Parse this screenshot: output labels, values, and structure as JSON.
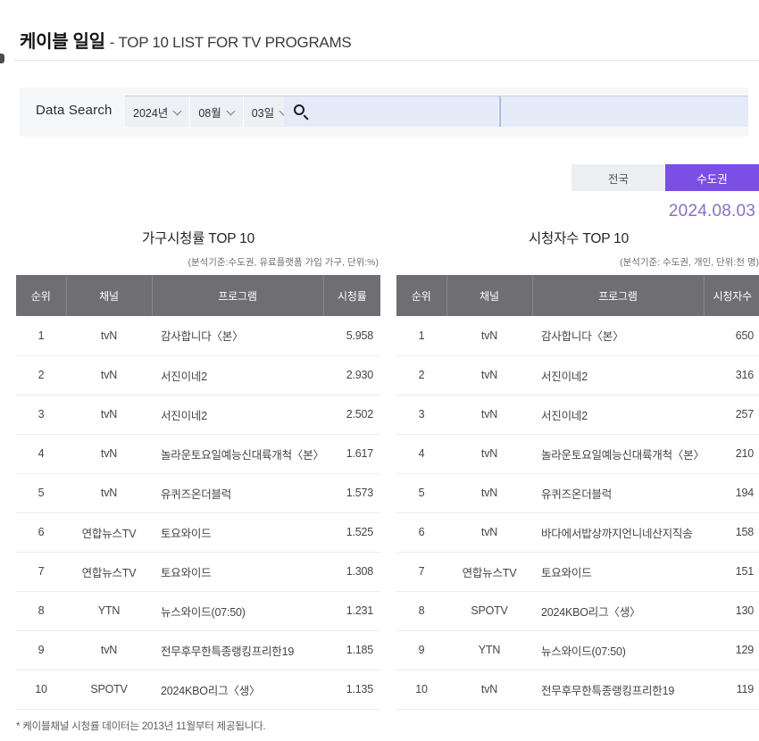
{
  "header": {
    "title_ko": "케이블 일일",
    "title_en": "- TOP 10 LIST FOR TV PROGRAMS"
  },
  "search": {
    "label": "Data Search",
    "year": "2024년",
    "month": "08월",
    "day": "03일",
    "search_icon": "search-icon",
    "chevron_icon": "chevron-down-icon"
  },
  "region_toggle": {
    "nationwide": "전국",
    "metro": "수도권",
    "active": "수도권",
    "active_color": "#7b4ee6",
    "inactive_color": "#eceef1"
  },
  "date_display": "2024.08.03",
  "accent_color": "#8a6fc4",
  "tables": [
    {
      "title": "가구시청률 TOP 10",
      "subtitle": "(분석기준:수도권, 유료플랫폼 가입 가구, 단위:%)",
      "columns": [
        "순위",
        "채널",
        "프로그램",
        "시청률"
      ],
      "rows": [
        {
          "rank": "1",
          "channel": "tvN",
          "program": "감사합니다〈본〉",
          "value": "5.958"
        },
        {
          "rank": "2",
          "channel": "tvN",
          "program": "서진이네2",
          "value": "2.930"
        },
        {
          "rank": "3",
          "channel": "tvN",
          "program": "서진이네2",
          "value": "2.502"
        },
        {
          "rank": "4",
          "channel": "tvN",
          "program": "놀라운토요일예능신대륙개척〈본〉",
          "value": "1.617"
        },
        {
          "rank": "5",
          "channel": "tvN",
          "program": "유퀴즈온더블럭",
          "value": "1.573"
        },
        {
          "rank": "6",
          "channel": "연합뉴스TV",
          "program": "토요와이드",
          "value": "1.525"
        },
        {
          "rank": "7",
          "channel": "연합뉴스TV",
          "program": "토요와이드",
          "value": "1.308"
        },
        {
          "rank": "8",
          "channel": "YTN",
          "program": "뉴스와이드(07:50)",
          "value": "1.231"
        },
        {
          "rank": "9",
          "channel": "tvN",
          "program": "전무후무한특종랭킹프리한19",
          "value": "1.185"
        },
        {
          "rank": "10",
          "channel": "SPOTV",
          "program": "2024KBO리그〈생〉",
          "value": "1.135"
        }
      ]
    },
    {
      "title": "시청자수 TOP 10",
      "subtitle": "(분석기준: 수도권, 개인, 단위:천 명)",
      "columns": [
        "순위",
        "채널",
        "프로그램",
        "시청자수"
      ],
      "rows": [
        {
          "rank": "1",
          "channel": "tvN",
          "program": "감사합니다〈본〉",
          "value": "650"
        },
        {
          "rank": "2",
          "channel": "tvN",
          "program": "서진이네2",
          "value": "316"
        },
        {
          "rank": "3",
          "channel": "tvN",
          "program": "서진이네2",
          "value": "257"
        },
        {
          "rank": "4",
          "channel": "tvN",
          "program": "놀라운토요일예능신대륙개척〈본〉",
          "value": "210"
        },
        {
          "rank": "5",
          "channel": "tvN",
          "program": "유퀴즈온더블럭",
          "value": "194"
        },
        {
          "rank": "6",
          "channel": "tvN",
          "program": "바다에서밥상까지언니네산지직송",
          "value": "158"
        },
        {
          "rank": "7",
          "channel": "연합뉴스TV",
          "program": "토요와이드",
          "value": "151"
        },
        {
          "rank": "8",
          "channel": "SPOTV",
          "program": "2024KBO리그〈생〉",
          "value": "130"
        },
        {
          "rank": "9",
          "channel": "YTN",
          "program": "뉴스와이드(07:50)",
          "value": "129"
        },
        {
          "rank": "10",
          "channel": "tvN",
          "program": "전무후무한특종랭킹프리한19",
          "value": "119"
        }
      ]
    }
  ],
  "footnote": "* 케이블채널 시청률 데이터는 2013년 11월부터 제공됩니다."
}
